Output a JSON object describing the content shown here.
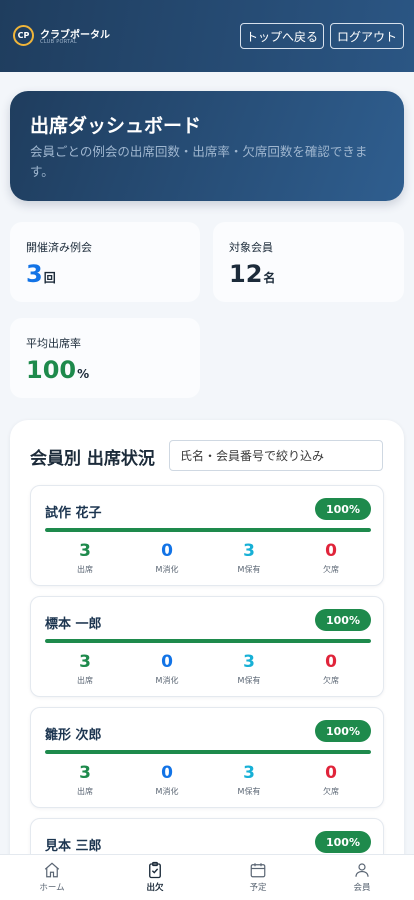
{
  "header": {
    "logo_mark": "CP",
    "brand_name": "クラブポータル",
    "brand_sub": "CLUB PORTAL",
    "top_button": "トップへ戻る",
    "logout_button": "ログアウト"
  },
  "hero": {
    "title": "出席ダッシュボード",
    "description": "会員ごとの例会の出席回数・出席率・欠席回数を確認できます。"
  },
  "stats": [
    {
      "label": "開催済み例会",
      "value": "3",
      "unit": "回",
      "color": "#1273e6"
    },
    {
      "label": "対象会員",
      "value": "12",
      "unit": "名",
      "color": "#1c2b3a"
    },
    {
      "label": "平均出席率",
      "value": "100",
      "unit": "%",
      "color": "#1e8a4c"
    }
  ],
  "members_section": {
    "title": "会員別 出席状況",
    "search_placeholder": "氏名・会員番号で絞り込み",
    "metric_labels": [
      "出席",
      "M消化",
      "M保有",
      "欠席"
    ],
    "members": [
      {
        "name": "試作 花子",
        "rate": "100%",
        "rate_fraction": 1.0,
        "attend": "3",
        "m_used": "0",
        "m_held": "3",
        "absent": "0"
      },
      {
        "name": "標本 一郎",
        "rate": "100%",
        "rate_fraction": 1.0,
        "attend": "3",
        "m_used": "0",
        "m_held": "3",
        "absent": "0"
      },
      {
        "name": "雛形 次郎",
        "rate": "100%",
        "rate_fraction": 1.0,
        "attend": "3",
        "m_used": "0",
        "m_held": "3",
        "absent": "0"
      },
      {
        "name": "見本 三郎",
        "rate": "100%",
        "rate_fraction": 1.0
      }
    ]
  },
  "bottom_nav": [
    {
      "label": "ホーム",
      "icon": "home-icon",
      "active": false
    },
    {
      "label": "出欠",
      "icon": "clipboard-check-icon",
      "active": true
    },
    {
      "label": "予定",
      "icon": "calendar-icon",
      "active": false
    },
    {
      "label": "会員",
      "icon": "user-icon",
      "active": false
    }
  ],
  "colors": {
    "header": "#1f3d5e",
    "accent_green": "#1e8a4c",
    "accent_blue": "#1273e6",
    "accent_cyan": "#17b0d6",
    "accent_red": "#e0243a",
    "logo_ring": "#f0b53a"
  }
}
